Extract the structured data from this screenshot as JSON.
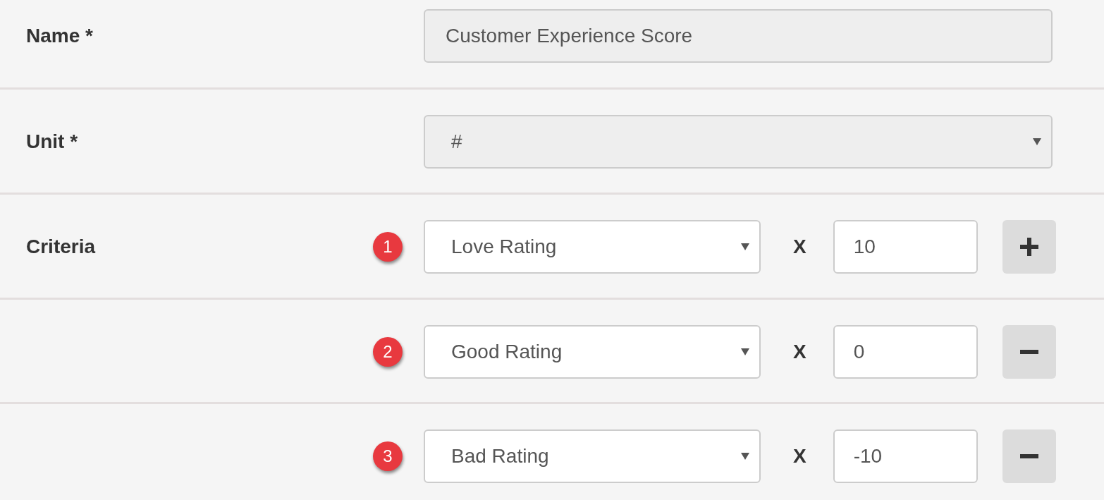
{
  "fields": [
    {
      "kind": "text",
      "label": "Name *",
      "value": "Customer Experience Score",
      "disabled": true
    },
    {
      "kind": "select",
      "label": "Unit *",
      "value": "#",
      "disabled": true
    }
  ],
  "criteria": {
    "label": "Criteria",
    "rows": [
      {
        "number": "1",
        "metric": "Love Rating",
        "operator": "X",
        "weight": "10",
        "kind": "add"
      },
      {
        "number": "2",
        "metric": "Good Rating",
        "operator": "X",
        "weight": "0",
        "kind": "remove"
      },
      {
        "number": "3",
        "metric": "Bad Rating",
        "operator": "X",
        "weight": "-10",
        "kind": "remove"
      }
    ]
  }
}
